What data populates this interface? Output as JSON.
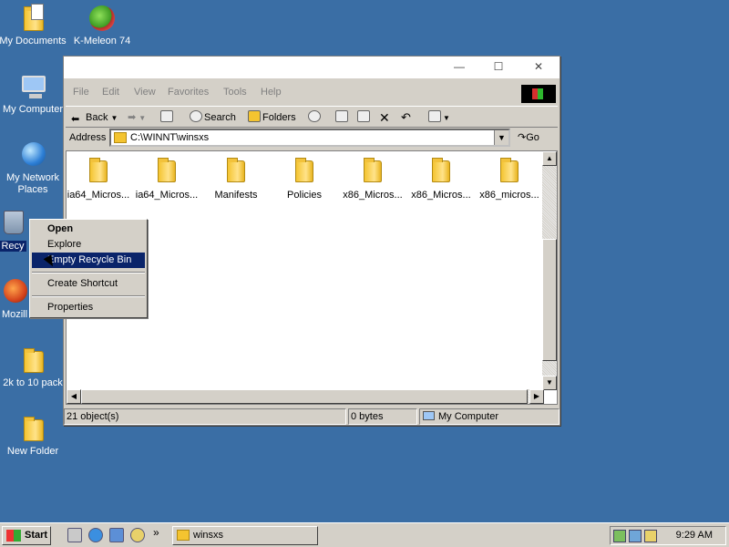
{
  "desktop": {
    "icons": [
      {
        "label": "My Documents",
        "icon": "my-documents-icon"
      },
      {
        "label": "K-Meleon 74",
        "icon": "k-meleon-icon"
      },
      {
        "label": "My Computer",
        "icon": "my-computer-icon"
      },
      {
        "label": "My Network Places",
        "icon": "network-places-icon"
      },
      {
        "label": "Recy",
        "icon": "recycle-bin-icon"
      },
      {
        "label": "Mozill",
        "icon": "mozilla-icon"
      },
      {
        "label": "2k to 10 pack",
        "icon": "folder-icon"
      },
      {
        "label": "New Folder",
        "icon": "folder-icon"
      }
    ]
  },
  "window": {
    "titlebar": {
      "minimize": "—",
      "maximize": "☐",
      "close": "✕"
    },
    "menu": [
      "File",
      "Edit",
      "View",
      "Favorites",
      "Tools",
      "Help"
    ],
    "toolbar": {
      "back": "Back",
      "search": "Search",
      "folders": "Folders"
    },
    "address": {
      "label": "Address",
      "value": "C:\\WINNT\\winsxs",
      "go": "Go"
    },
    "files": [
      "ia64_Micros...",
      "ia64_Micros...",
      "Manifests",
      "Policies",
      "x86_Micros...",
      "x86_Micros...",
      "x86_micros..."
    ],
    "status": {
      "objects": "21 object(s)",
      "size": "0 bytes",
      "location": "My Computer"
    }
  },
  "context_menu": {
    "items": [
      "Open",
      "Explore",
      "Empty Recycle Bin",
      "Create Shortcut",
      "Properties"
    ],
    "highlighted": "Empty Recycle Bin",
    "default": "Open"
  },
  "taskbar": {
    "start": "Start",
    "task": "winsxs",
    "clock": "9:29 AM",
    "chevron": "»"
  },
  "colors": {
    "desktop": "#3a6ea5",
    "highlight": "#0a246a",
    "face": "#d4d0c8"
  }
}
